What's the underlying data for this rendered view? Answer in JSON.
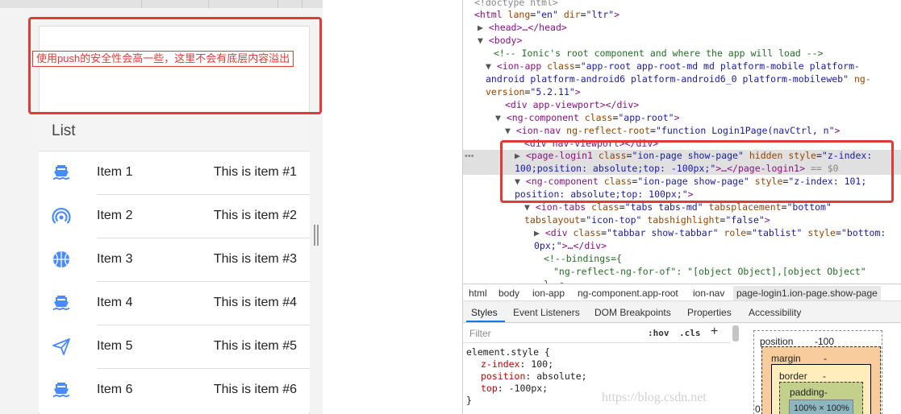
{
  "device": {
    "annotation": "使用push的安全性会高一些，这里不会有底层内容溢出",
    "list_title": "List",
    "items": [
      {
        "icon": "boat-icon",
        "title": "Item 1",
        "note": "This is item #1"
      },
      {
        "icon": "wifi-icon",
        "title": "Item 2",
        "note": "This is item #2"
      },
      {
        "icon": "basketball-icon",
        "title": "Item 3",
        "note": "This is item #3"
      },
      {
        "icon": "boat-icon",
        "title": "Item 4",
        "note": "This is item #4"
      },
      {
        "icon": "paper-plane-icon",
        "title": "Item 5",
        "note": "This is item #5"
      },
      {
        "icon": "boat-icon",
        "title": "Item 6",
        "note": "This is item #6"
      }
    ],
    "icon_color": "#488aff",
    "annotation_color": "#e53935"
  },
  "devtools": {
    "dom": {
      "l0": "<!doctype html>",
      "l1_open": "<html ",
      "l1_attr1": "lang",
      "l1_val1": "\"en\"",
      "l1_attr2": "dir",
      "l1_val2": "\"ltr\"",
      "l1_close": ">",
      "l2": "<head>…</head>",
      "l3": "<body>",
      "l4": "<!-- Ionic's root component and where the app will load -->",
      "l5_tag": "<ion-app ",
      "l5_attr": "class",
      "l5_val": "\"app-root app-root-md md platform-mobile platform-",
      "l6_val": "android platform-android6 platform-android6_0 platform-mobileweb\"",
      "l6_attr": "ng-",
      "l7_attr": "version",
      "l7_val": "\"5.2.11\"",
      "l7_close": ">",
      "l8": "<div app-viewport></div>",
      "l9_tag": "<ng-component ",
      "l9_attr": "class",
      "l9_val": "\"app-root\"",
      "l9_close": ">",
      "l10_tag": "<ion-nav ",
      "l10_attr": "ng-reflect-root",
      "l10_val": "\"function Login1Page(navCtrl, n\"",
      "l10_close": ">",
      "l11": "<div nav-viewport></div>",
      "l12_tag": "<page-login1 ",
      "l12_attr1": "class",
      "l12_val1": "\"ion-page show-page\"",
      "l12_attr2": "hidden",
      "l12_attr3": "style",
      "l12_val3": "\"z-index:",
      "l13_val": "100;position: absolute;top: -100px;\"",
      "l13_close": ">…</page-login1>",
      "l13_eq": " == $0",
      "l14_tag": "<ng-component ",
      "l14_attr1": "class",
      "l14_val1": "\"ion-page show-page\"",
      "l14_attr2": "style",
      "l14_val2": "\"z-index: 101;",
      "l15_val": "position: absolute;top: 100px;\"",
      "l15_close": ">",
      "l16_tag": "<ion-tabs ",
      "l16_attr1": "class",
      "l16_val1": "\"tabs tabs-md\"",
      "l16_attr2": "tabsplacement",
      "l16_val2": "\"bottom\"",
      "l17_attr1": "tabslayout",
      "l17_val1": "\"icon-top\"",
      "l17_attr2": "tabshighlight",
      "l17_val2": "\"false\"",
      "l17_close": ">",
      "l18_tag": "<div ",
      "l18_attr1": "class",
      "l18_val1": "\"tabbar show-tabbar\"",
      "l18_attr2": "role",
      "l18_val2": "\"tablist\"",
      "l18_attr3": "style",
      "l18_val3": "\"bottom:",
      "l19_val": "0px;\"",
      "l19_close": ">…</div>",
      "l20": "<!--bindings={",
      "l21": "\"ng-reflect-ng-for-of\": \"[object Object],[object Object\"",
      "l22": "}-->"
    },
    "breadcrumbs": [
      "html",
      "body",
      "ion-app",
      "ng-component.app-root",
      "ion-nav",
      "page-login1.ion-page.show-page"
    ],
    "tabs": [
      "Styles",
      "Event Listeners",
      "DOM Breakpoints",
      "Properties",
      "Accessibility"
    ],
    "filter": {
      "placeholder": "Filter",
      "hov": ":hov",
      "cls": ".cls",
      "plus": "+"
    },
    "styles": {
      "selector": "element.style {",
      "rules": [
        {
          "prop": "z-index",
          "value": "100;"
        },
        {
          "prop": "position",
          "value": "absolute;"
        },
        {
          "prop": "top",
          "value": "-100px;"
        }
      ],
      "close": "}"
    },
    "box_model": {
      "position_label": "position",
      "position_value": "-100",
      "margin_label": "margin",
      "margin_value": "-",
      "border_label": "border",
      "border_value": "-",
      "padding_label": "padding-",
      "content": "100% × 100%",
      "left_value": "0"
    },
    "watermark": "https://blog.csdn.net"
  }
}
